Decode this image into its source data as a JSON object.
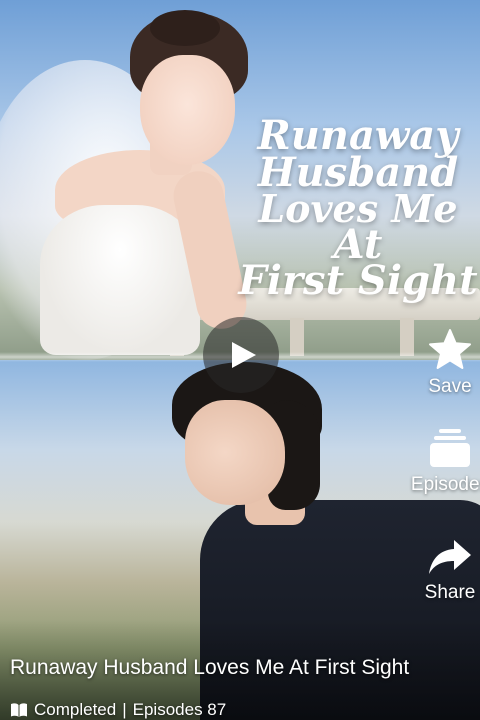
{
  "poster": {
    "title_art_lines": [
      "Runaway",
      "Husband",
      "Loves Me",
      "At",
      "First Sight"
    ]
  },
  "controls": {
    "play_icon": "play-icon"
  },
  "actions": {
    "save": {
      "label": "Save",
      "icon": "star-icon"
    },
    "episodes": {
      "label": "Episodes",
      "icon": "episodes-stack-icon"
    },
    "share": {
      "label": "Share",
      "icon": "share-arrow-icon"
    }
  },
  "info": {
    "title": "Runaway Husband Loves Me At First Sight",
    "status": "Completed",
    "separator": "|",
    "episodes_text": "Episodes 87",
    "status_icon": "book-icon"
  }
}
